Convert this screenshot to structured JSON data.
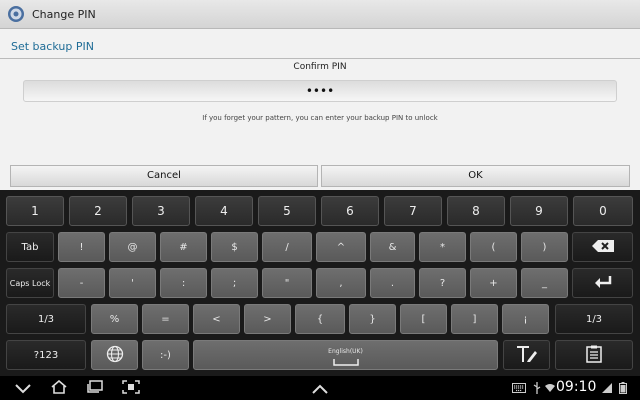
{
  "title_bar": {
    "title": "Change PIN"
  },
  "section": {
    "header": "Set backup PIN"
  },
  "form": {
    "confirm_label": "Confirm PIN",
    "pin_value": "••••",
    "hint": "If you forget your pattern, you can enter your backup PIN to unlock"
  },
  "buttons": {
    "cancel": "Cancel",
    "ok": "OK"
  },
  "keyboard": {
    "row1": [
      "1",
      "2",
      "3",
      "4",
      "5",
      "6",
      "7",
      "8",
      "9",
      "0"
    ],
    "row2_lead": "Tab",
    "row2": [
      "!",
      "@",
      "#",
      "$",
      "/",
      "^",
      "&",
      "*",
      "(",
      ")"
    ],
    "row3_lead": "Caps Lock",
    "row3": [
      "-",
      "'",
      ":",
      ";",
      "\"",
      ",",
      ".",
      "?",
      "+",
      "_"
    ],
    "row4_left": "1/3",
    "row4": [
      "%",
      "=",
      "<",
      ">",
      "{",
      "}",
      "[",
      "]",
      "¡"
    ],
    "row4_right": "1/3",
    "row5_sym": "?123",
    "emoticon": ":-)",
    "space_label": "English(UK)"
  },
  "status_bar": {
    "time": "09:10"
  },
  "icons": {
    "app": "settings-gear-icon",
    "backspace": "backspace-icon",
    "enter": "enter-icon",
    "globe": "globe-icon",
    "handwriting": "handwriting-icon",
    "clipboard": "clipboard-icon",
    "back": "back-icon",
    "home": "home-icon",
    "recent": "recent-apps-icon",
    "screenshot": "screenshot-icon",
    "up": "up-icon",
    "keyboard": "keyboard-icon",
    "usb": "usb-icon",
    "wifi": "wifi-icon",
    "signal": "signal-icon",
    "battery": "battery-icon"
  },
  "colors": {
    "accent": "#1f6c96",
    "keyboard_bg": "#1a1a1a"
  }
}
